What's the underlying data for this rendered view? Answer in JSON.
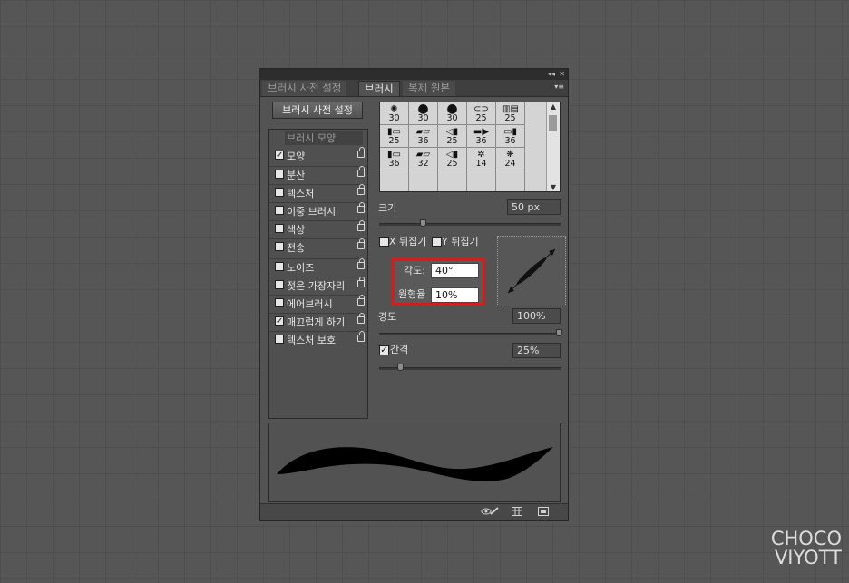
{
  "panel": {
    "topbar": {
      "collapse": "◂◂",
      "close": "✕"
    },
    "tabs": [
      "브러시 사전 설정",
      "브러시",
      "복제 원본"
    ],
    "menu_icon": "▾≡",
    "preset_button": "브러시 사전 설정",
    "options": {
      "header": "브러시 모양",
      "items": [
        {
          "label": "모양",
          "checked": true
        },
        {
          "label": "분산",
          "checked": false
        },
        {
          "label": "텍스처",
          "checked": false
        },
        {
          "label": "이중 브러시",
          "checked": false
        },
        {
          "label": "색상",
          "checked": false
        },
        {
          "label": "전송",
          "checked": false
        },
        {
          "label": "노이즈",
          "checked": false
        },
        {
          "label": "젖은 가장자리",
          "checked": false
        },
        {
          "label": "에어브러시",
          "checked": false
        },
        {
          "label": "매끄럽게 하기",
          "checked": true
        },
        {
          "label": "텍스처 보호",
          "checked": false
        }
      ]
    },
    "brush_tiles": [
      {
        "size": "30",
        "icon": "soft-round-brush-icon"
      },
      {
        "size": "30",
        "icon": "hard-round-brush-icon"
      },
      {
        "size": "30",
        "icon": "hard-round-brush-icon"
      },
      {
        "size": "25",
        "icon": "bristle-brush-icon"
      },
      {
        "size": "25",
        "icon": "flat-bristle-brush-icon"
      },
      {
        "size": "25",
        "icon": "bristle-brush-icon"
      },
      {
        "size": "36",
        "icon": "flat-bristle-brush-icon"
      },
      {
        "size": "25",
        "icon": "fan-brush-icon"
      },
      {
        "size": "36",
        "icon": "bristle-brush-icon"
      },
      {
        "size": "36",
        "icon": "flat-bristle-brush-icon"
      },
      {
        "size": "36",
        "icon": "bristle-brush-icon"
      },
      {
        "size": "32",
        "icon": "flat-bristle-brush-icon"
      },
      {
        "size": "25",
        "icon": "fan-brush-icon"
      },
      {
        "size": "14",
        "icon": "scatter-brush-icon"
      },
      {
        "size": "24",
        "icon": "texture-brush-icon"
      }
    ],
    "size": {
      "label": "크기",
      "value": "50 px"
    },
    "flip_x": {
      "label": "X 뒤집기",
      "checked": false
    },
    "flip_y": {
      "label": "Y 뒤집기",
      "checked": false
    },
    "angle": {
      "label": "각도:",
      "value": "40°"
    },
    "roundness": {
      "label": "원형율",
      "value": "10%"
    },
    "hardness": {
      "label": "경도",
      "value": "100%"
    },
    "spacing": {
      "label": "간격",
      "value": "25%",
      "checked": true
    },
    "bottom_icons": [
      "eye-brush-icon",
      "grid-panel-icon",
      "new-preset-icon"
    ]
  },
  "watermark": {
    "line1": "CHOCO",
    "line2": "VIYOTT"
  }
}
